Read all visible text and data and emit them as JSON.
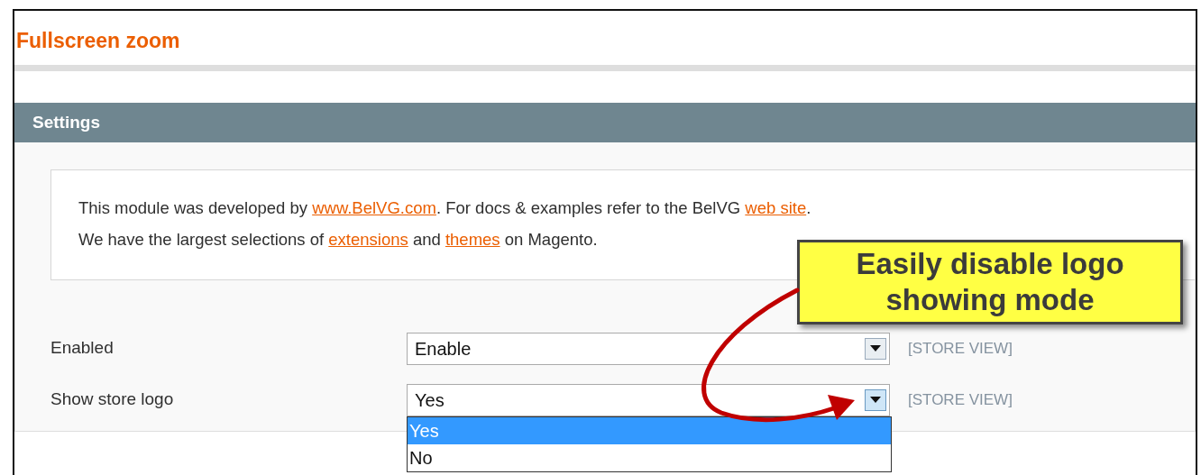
{
  "page": {
    "title": "Fullscreen zoom"
  },
  "section": {
    "title": "Settings"
  },
  "notice": {
    "lines": [
      [
        {
          "kind": "text",
          "text": "This module was developed by "
        },
        {
          "kind": "link",
          "text": "www.BelVG.com"
        },
        {
          "kind": "text",
          "text": ". For docs & examples refer to the BelVG "
        },
        {
          "kind": "link",
          "text": "web site"
        },
        {
          "kind": "text",
          "text": "."
        }
      ],
      [
        {
          "kind": "text",
          "text": "We have the largest selections of "
        },
        {
          "kind": "link",
          "text": "extensions"
        },
        {
          "kind": "text",
          "text": " and "
        },
        {
          "kind": "link",
          "text": "themes"
        },
        {
          "kind": "text",
          "text": " on Magento."
        }
      ]
    ]
  },
  "fields": [
    {
      "label": "Enabled",
      "value": "Enable",
      "scope": "[STORE VIEW]",
      "expanded": false
    },
    {
      "label": "Show store logo",
      "value": "Yes",
      "scope": "[STORE VIEW]",
      "expanded": true,
      "options": [
        {
          "label": "Yes",
          "selected": true
        },
        {
          "label": "No",
          "selected": false
        }
      ]
    }
  ],
  "callout": {
    "text": "Easily disable logo showing mode"
  }
}
